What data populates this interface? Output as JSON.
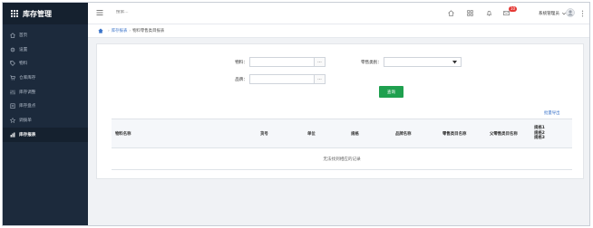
{
  "app": {
    "title": "库存管理"
  },
  "sidebar": {
    "items": [
      {
        "label": "首页",
        "icon": "home-outline-icon"
      },
      {
        "label": "设置",
        "icon": "gear-icon"
      },
      {
        "label": "物料",
        "icon": "tag-icon"
      },
      {
        "label": "仓库库存",
        "icon": "cart-icon"
      },
      {
        "label": "库存调整",
        "icon": "sliders-icon"
      },
      {
        "label": "库存盘点",
        "icon": "clipboard-icon"
      },
      {
        "label": "调拨单",
        "icon": "star-icon"
      },
      {
        "label": "库存报表",
        "icon": "bar-chart-icon",
        "active": true
      }
    ]
  },
  "header": {
    "search_placeholder": "搜索...",
    "notification_count": "10",
    "user_name": "系统管理员"
  },
  "breadcrumb": {
    "parent": "库存报表",
    "current": "物料零售类目报表"
  },
  "filters": {
    "material_label": "物料：",
    "material_value": "",
    "brand_label": "品牌：",
    "brand_value": "",
    "retail_category_label": "零售类别：",
    "retail_category_value": "",
    "picker_label": "···",
    "search_button": "查询"
  },
  "export_label": "批量导出",
  "table": {
    "columns": [
      "物料名称",
      "货号",
      "单位",
      "规格",
      "品牌名称",
      "零售类目名称",
      "父零售类目名称"
    ],
    "last_column": [
      "规格1",
      "规格2",
      "规格3"
    ],
    "empty_text": "无法找到相应的记录"
  },
  "colors": {
    "sidebar_bg": "#1c2a3c",
    "primary_button": "#1fa04f",
    "link": "#3a73c9",
    "badge": "#e53935"
  }
}
